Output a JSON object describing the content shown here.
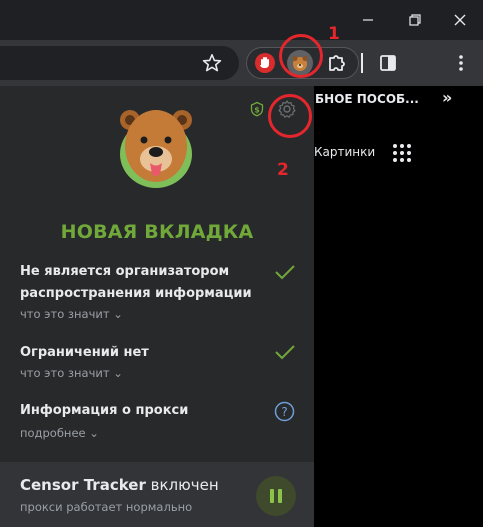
{
  "window": {
    "minimize_icon": "minimize-icon",
    "maximize_icon": "restore-icon",
    "close_icon": "close-icon"
  },
  "bookmarks": {
    "folder_label": "БНОЕ ПОСОБ...",
    "overflow": "»"
  },
  "new_tab_page": {
    "images_link": "Картинки"
  },
  "annotations": {
    "marker_1": "1",
    "marker_2": "2",
    "color": "#e4262d"
  },
  "popup": {
    "title": "НОВАЯ ВКЛАДКА",
    "accent_color": "#71a83a",
    "items": [
      {
        "label_line1": "Не является организатором",
        "label_line2": "распространения информации",
        "link": "что это значит",
        "status_icon": "check-icon"
      },
      {
        "label": "Ограничений нет",
        "link": "что это значит",
        "status_icon": "check-icon"
      },
      {
        "label": "Информация о прокси",
        "link": "подробнее",
        "status_icon": "help-icon"
      }
    ],
    "footer": {
      "app_name": "Censor Tracker",
      "state": "включен",
      "status": "прокси работает нормально"
    }
  }
}
